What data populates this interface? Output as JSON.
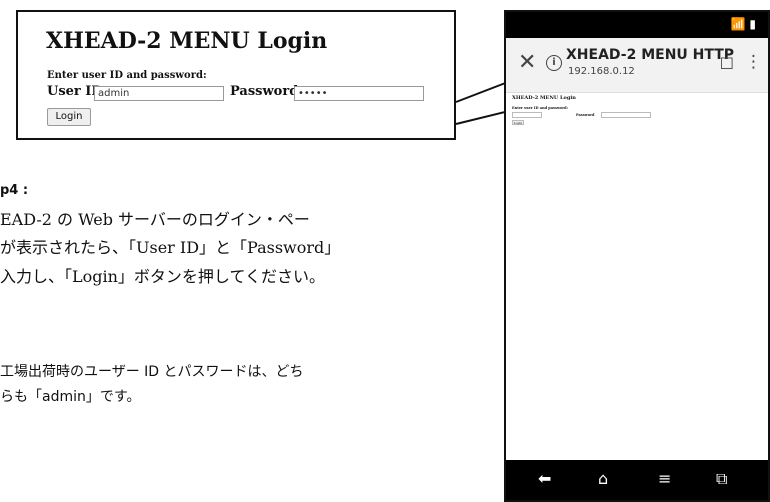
{
  "zoom": {
    "title": "XHEAD-2 MENU Login",
    "instruction": "Enter user ID and password:",
    "user_id_label": "User ID",
    "user_id_value": "admin",
    "password_label": "Password",
    "password_value": "•••••",
    "login_button": "Login"
  },
  "instructions": {
    "step_title": "p4 :",
    "step_lines": [
      "EAD-2 の Web サーバーのログイン・ペー",
      "が表示されたら、「User ID」と「Password」",
      "入力し、「Login」ボタンを押してください。"
    ],
    "note_lines": [
      "工場出荷時のユーザー ID とパスワードは、どち",
      "らも「admin」です。"
    ]
  },
  "phone": {
    "status_icons": "📶 ▮",
    "browser": {
      "title": "XHEAD-2 MENU HTTP",
      "url": "192.168.0.12"
    },
    "page": {
      "title": "XHEAD-2 MENU Login",
      "instruction": "Enter user ID and password:",
      "password_label": "Password",
      "login_button": "Login"
    },
    "nav_icons": [
      "back-icon",
      "home-icon",
      "menu-icon",
      "tabs-icon"
    ]
  }
}
